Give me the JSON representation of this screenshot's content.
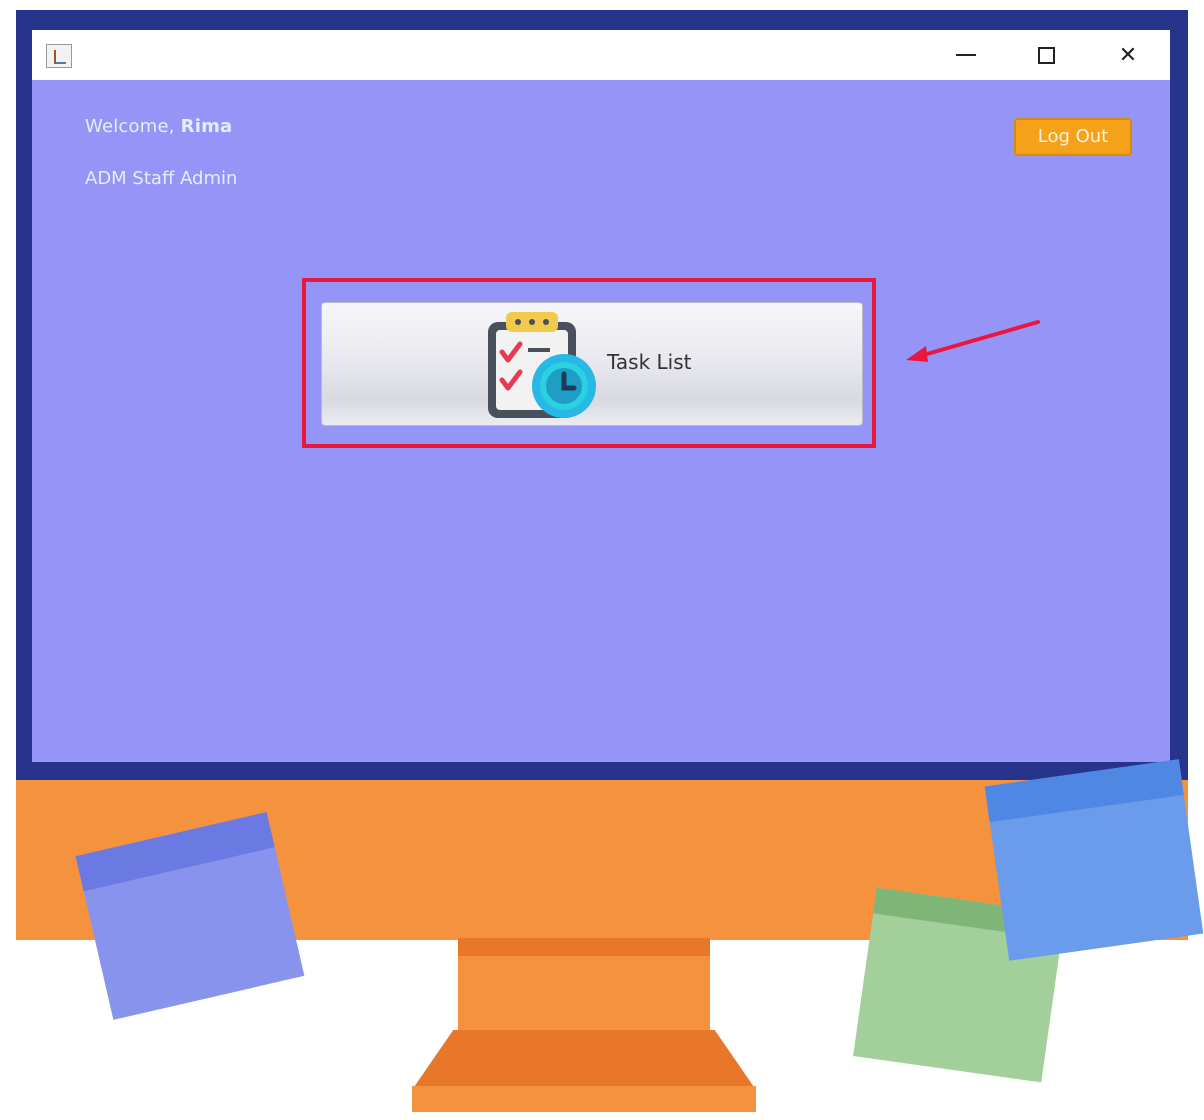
{
  "window": {
    "controls": {
      "minimize_icon": "minimize-icon",
      "maximize_icon": "maximize-icon",
      "close_icon": "close-icon",
      "close_glyph": "✕"
    }
  },
  "header": {
    "welcome_prefix": "Welcome,",
    "user_name": "Rima",
    "role_text": "ADM Staff Admin",
    "logout_label": "Log Out"
  },
  "main": {
    "task_button_label": "Task List",
    "task_button_icon": "task-list-clock-icon"
  },
  "colors": {
    "window_bg": "#9595f8",
    "monitor_frame": "#26348c",
    "monitor_base": "#f5923e",
    "logout_bg": "#f5a21a",
    "highlight": "#e8173b"
  }
}
